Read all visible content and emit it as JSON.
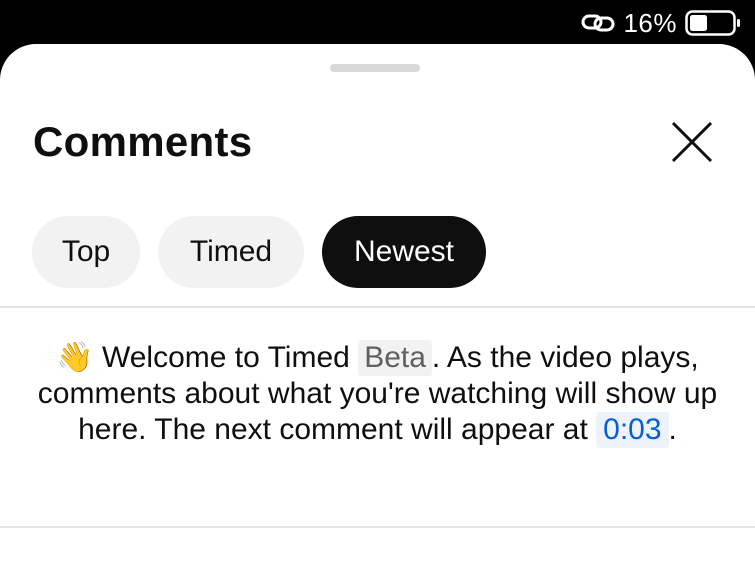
{
  "status_bar": {
    "battery_percent": "16%",
    "battery_level": 0.16,
    "icons": [
      "link-icon",
      "battery-icon"
    ]
  },
  "panel": {
    "title": "Comments",
    "close_icon": "close-icon"
  },
  "filters": {
    "chips": [
      {
        "label": "Top",
        "active": false
      },
      {
        "label": "Timed",
        "active": false
      },
      {
        "label": "Newest",
        "active": true
      }
    ]
  },
  "welcome_message": {
    "icon": "waving-hand-icon",
    "emoji": "👋",
    "text_before_badge": "Welcome to Timed",
    "badge": "Beta",
    "text_after_badge": ". As the video plays, comments about what you're watching will show up here. The next comment will appear at",
    "timestamp": "0:03",
    "text_end": "."
  },
  "colors": {
    "accent_link": "#065fd4",
    "active_chip_bg": "#0f0f0f",
    "chip_bg": "#f2f2f2"
  }
}
